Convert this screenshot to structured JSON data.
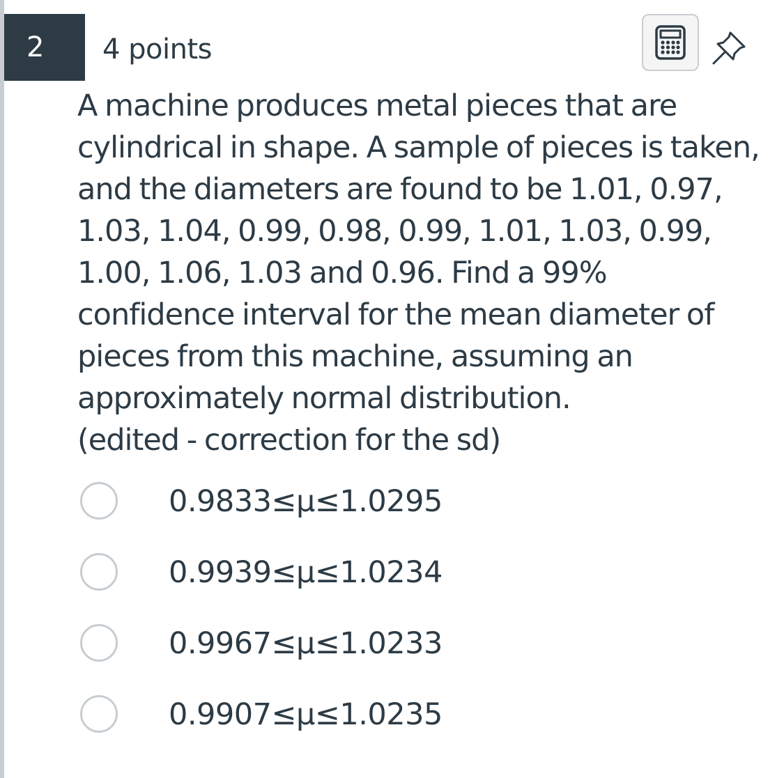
{
  "question": {
    "number": "2",
    "points": "4 points",
    "text": "A machine produces metal pieces that are cylindrical in shape. A sample of pieces is taken, and the diameters are found to be 1.01, 0.97, 1.03, 1.04, 0.99, 0.98, 0.99, 1.01, 1.03, 0.99, 1.00, 1.06, 1.03 and 0.96. Find a 99% confidence interval for the mean diameter of pieces from this machine, assuming an approximately normal distribution.",
    "note": "(edited - correction for the sd)"
  },
  "toolbar": {
    "calculator_icon": "calculator-icon",
    "pin_icon": "pin-icon"
  },
  "options": [
    {
      "label": "0.9833≤μ≤1.0295",
      "selected": false
    },
    {
      "label": "0.9939≤μ≤1.0234",
      "selected": false
    },
    {
      "label": "0.9967≤μ≤1.0233",
      "selected": false
    },
    {
      "label": "0.9907≤μ≤1.0235",
      "selected": false
    }
  ],
  "colors": {
    "badge_bg": "#2d3b45",
    "text": "#2d3b45",
    "border": "#c7cdd1"
  }
}
